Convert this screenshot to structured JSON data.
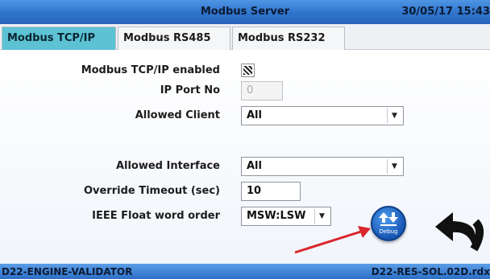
{
  "header": {
    "title": "Modbus Server",
    "datetime": "30/05/17 15:43"
  },
  "tabs": [
    {
      "label": "Modbus TCP/IP",
      "active": true
    },
    {
      "label": "Modbus RS485",
      "active": false
    },
    {
      "label": "Modbus RS232",
      "active": false
    }
  ],
  "form": {
    "tcp_enabled_label": "Modbus TCP/IP enabled",
    "tcp_enabled": true,
    "ip_port_label": "IP Port No",
    "ip_port_value": "0",
    "allowed_client_label": "Allowed Client",
    "allowed_client_value": "All",
    "allowed_interface_label": "Allowed Interface",
    "allowed_interface_value": "All",
    "override_timeout_label": "Override Timeout (sec)",
    "override_timeout_value": "10",
    "float_order_label": "IEEE Float word order",
    "float_order_value": "MSW:LSW"
  },
  "buttons": {
    "debug_caption": "Debug"
  },
  "status": {
    "left": "D22-ENGINE-VALIDATOR",
    "right": "D22-RES-SOL.02D.rdx"
  },
  "colors": {
    "titlebar": "#2f74cc",
    "active_tab": "#5cc2d4",
    "annotation_arrow": "#d9262c"
  }
}
